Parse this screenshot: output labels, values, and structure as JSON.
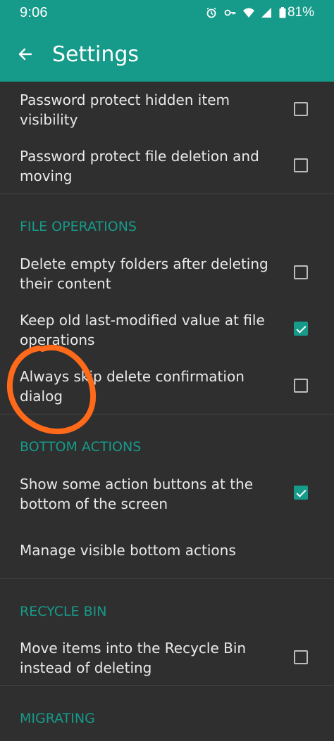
{
  "status": {
    "time": "9:06",
    "battery": "81%"
  },
  "appbar": {
    "title": "Settings"
  },
  "items": {
    "hidden_item": "Password protect hidden item visibility",
    "file_deletion": "Password protect file deletion and moving",
    "delete_empty": "Delete empty folders after deleting their content",
    "keep_modified": "Keep old last-modified value at file operations",
    "skip_confirm": "Always skip delete confirmation dialog",
    "show_bottom": "Show some action buttons at the bottom of the screen",
    "manage_bottom": "Manage visible bottom actions",
    "recycle_move": "Move items into the Recycle Bin instead of deleting"
  },
  "sections": {
    "file_ops": "FILE OPERATIONS",
    "bottom_actions": "BOTTOM ACTIONS",
    "recycle_bin": "RECYCLE BIN",
    "migrating": "MIGRATING"
  },
  "checkboxes": {
    "hidden_item": false,
    "file_deletion": false,
    "delete_empty": false,
    "keep_modified": true,
    "skip_confirm": false,
    "show_bottom": true,
    "recycle_move": false
  },
  "colors": {
    "accent": "#169a8a",
    "background": "#2f2f2f",
    "annotation": "#ff6a1a"
  },
  "icons": {
    "back": "arrow-back-icon",
    "alarm": "alarm-icon",
    "key": "key-icon",
    "wifi": "wifi-icon",
    "signal": "signal-icon",
    "battery": "battery-icon"
  }
}
